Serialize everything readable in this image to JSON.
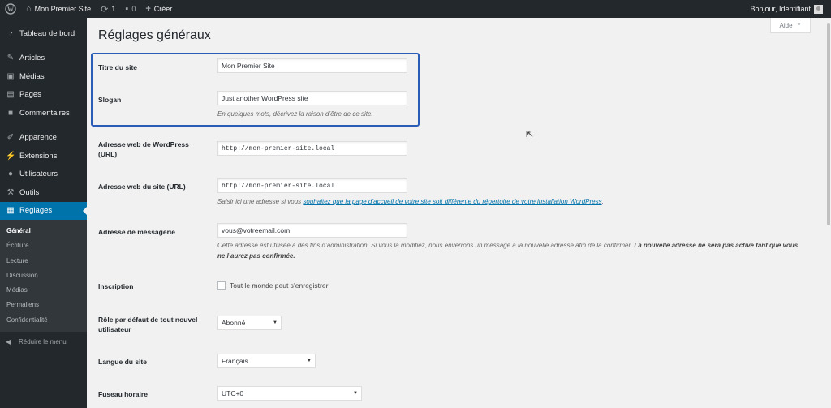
{
  "adminbar": {
    "site_name": "Mon Premier Site",
    "updates_count": "1",
    "comments_count": "0",
    "new_label": "Créer",
    "greeting": "Bonjour, Identifiant"
  },
  "sidebar": {
    "items": [
      {
        "label": "Tableau de bord",
        "icon": "dashboard-icon"
      },
      {
        "label": "Articles",
        "icon": "pin-icon"
      },
      {
        "label": "Médias",
        "icon": "media-icon"
      },
      {
        "label": "Pages",
        "icon": "page-icon"
      },
      {
        "label": "Commentaires",
        "icon": "comment-icon"
      },
      {
        "label": "Apparence",
        "icon": "brush-icon"
      },
      {
        "label": "Extensions",
        "icon": "plugin-icon"
      },
      {
        "label": "Utilisateurs",
        "icon": "user-icon"
      },
      {
        "label": "Outils",
        "icon": "wrench-icon"
      },
      {
        "label": "Réglages",
        "icon": "settings-icon"
      }
    ],
    "submenu": [
      "Général",
      "Écriture",
      "Lecture",
      "Discussion",
      "Médias",
      "Permaliens",
      "Confidentialité"
    ],
    "collapse_label": "Réduire le menu"
  },
  "main": {
    "help_label": "Aide",
    "title": "Réglages généraux",
    "site_title_label": "Titre du site",
    "site_title_value": "Mon Premier Site",
    "tagline_label": "Slogan",
    "tagline_value": "Just another WordPress site",
    "tagline_desc": "En quelques mots, décrivez la raison d’être de ce site.",
    "wp_url_label": "Adresse web de WordPress (URL)",
    "wp_url_value": "http://mon-premier-site.local",
    "site_url_label": "Adresse web du site (URL)",
    "site_url_value": "http://mon-premier-site.local",
    "site_url_desc_pre": "Saisir ici une adresse si vous ",
    "site_url_desc_link": "souhaitez que la page d’accueil de votre site soit différente du répertoire de votre installation WordPress",
    "site_url_desc_post": ".",
    "email_label": "Adresse de messagerie",
    "email_value": "vous@votreemail.com",
    "email_desc": "Cette adresse est utilisée à des fins d’administration. Si vous la modifiez, nous enverrons un message à la nouvelle adresse afin de la confirmer.",
    "email_desc_bold": "La nouvelle adresse ne sera pas active tant que vous ne l’aurez pas confirmée.",
    "membership_label": "Inscription",
    "membership_checkbox_label": "Tout le monde peut s’enregistrer",
    "default_role_label": "Rôle par défaut de tout nouvel utilisateur",
    "default_role_value": "Abonné",
    "language_label": "Langue du site",
    "language_value": "Français",
    "timezone_label": "Fuseau horaire",
    "timezone_value": "UTC+0"
  },
  "colors": {
    "adminbar_bg": "#23282d",
    "accent": "#0073aa",
    "highlight_border": "#2a5db5"
  }
}
